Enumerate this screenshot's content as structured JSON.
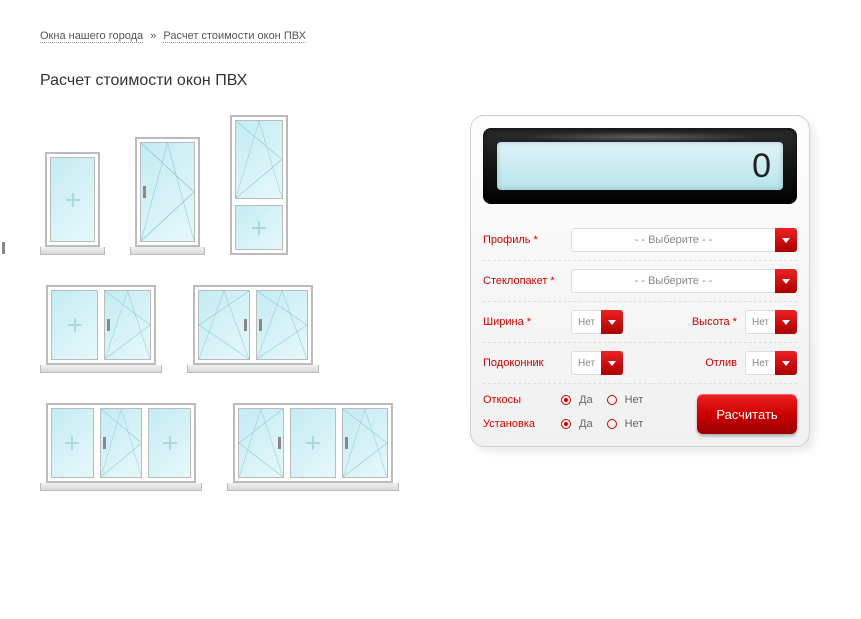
{
  "breadcrumb": {
    "home": "Окна нашего города",
    "sep": "»",
    "current": "Расчет стоимости окон ПВХ"
  },
  "title": "Расчет стоимости окон ПВХ",
  "calculator": {
    "display_value": "0",
    "fields": {
      "profile_label": "Профиль *",
      "profile_placeholder": "- - Выберите - -",
      "glazing_label": "Стеклопакет *",
      "glazing_placeholder": "- - Выберите - -",
      "width_label": "Ширина *",
      "width_value": "Нет",
      "height_label": "Высота *",
      "height_value": "Нет",
      "sill_label": "Подоконник",
      "sill_value": "Нет",
      "ebb_label": "Отлив",
      "ebb_value": "Нет"
    },
    "radios": {
      "slopes_label": "Откосы",
      "install_label": "Установка",
      "yes": "Да",
      "no": "Нет",
      "slopes_value": "Да",
      "install_value": "Да"
    },
    "button": "Расчитать"
  }
}
